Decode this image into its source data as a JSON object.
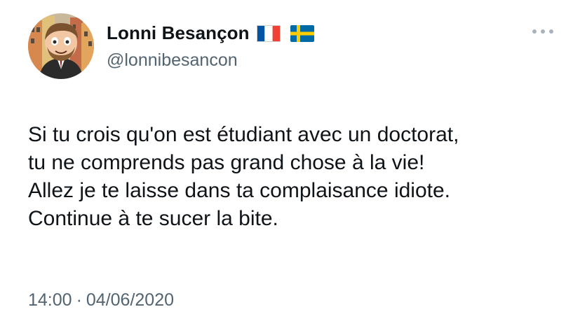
{
  "author": {
    "display_name": "Lonni Besançon",
    "handle": "@lonnibesancon",
    "flags": [
      {
        "icon": "france-flag-icon",
        "colors": [
          "#0055A4",
          "#FFFFFF",
          "#EF4135"
        ]
      },
      {
        "icon": "sweden-flag-icon",
        "colors": [
          "#006AA7",
          "#FECC00"
        ]
      }
    ],
    "avatar_icon": "avatar-cartoon-icon"
  },
  "more_menu_icon": "more-options-icon",
  "tweet": {
    "lines": [
      "Si tu crois qu'on est étudiant avec un doctorat,",
      "tu ne comprends pas grand chose à la vie!",
      "Allez je te laisse dans ta complaisance idiote.",
      "Continue à te sucer la bite."
    ]
  },
  "meta": {
    "time": "14:00",
    "separator": "·",
    "date": "04/06/2020"
  },
  "colors": {
    "text_primary": "#0f1419",
    "text_secondary": "#536471"
  }
}
